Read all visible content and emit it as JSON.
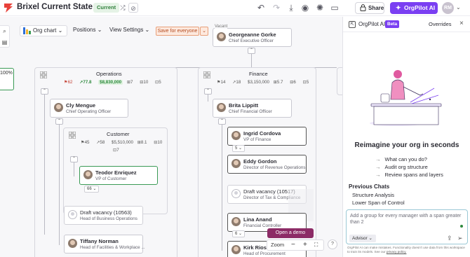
{
  "header": {
    "title": "Brixel Current State",
    "badge": "Current",
    "share_label": "Share",
    "orgpilot_label": "OrgPilot AI",
    "user_initials": "RM",
    "colors": {
      "accent": "#7a3ff2",
      "current_badge": "#2f7f3a"
    }
  },
  "toolbar": {
    "orgchart_label": "Org chart",
    "positions_label": "Positions",
    "view_settings_label": "View Settings",
    "save_label": "Save for everyone"
  },
  "chart": {
    "partial_left_label": "100%",
    "ceo": {
      "name": "Georgeanne Gorke",
      "role": "Chief Executive Officer",
      "tag": "Vacant"
    },
    "operations": {
      "title": "Operations",
      "stats": [
        "62",
        "77.8",
        "$8,830,000",
        "7",
        "10",
        "5"
      ],
      "head": {
        "name": "Cly Mengue",
        "role": "Chief Operating Officer"
      },
      "customer_group": {
        "title": "Customer",
        "stats": [
          "45",
          "58",
          "$5,510,000",
          "8.1",
          "10",
          "7"
        ],
        "head": {
          "name": "Teodor Enriquez",
          "role": "VP of Customer"
        },
        "count": "66"
      },
      "vacancy": {
        "name": "Draft vacancy (10563)",
        "role": "Head of Business Operations"
      },
      "tiffany": {
        "name": "Tiffany Norman",
        "role": "Head of Facilities & Workplace ..."
      }
    },
    "finance": {
      "title": "Finance",
      "stats": [
        "14",
        "18",
        "$3,150,000",
        "5.7",
        "6",
        "5"
      ],
      "head": {
        "name": "Brita Lippitt",
        "role": "Chief Financial Officer"
      },
      "ingrid": {
        "name": "Ingrid Cordova",
        "role": "VP of Finance",
        "count": "5"
      },
      "eddy": {
        "name": "Eddy Gordon",
        "role": "Director of Revenue Operations"
      },
      "vacancy": {
        "name": "Draft vacancy (10517)",
        "role": "Director of Tax & Compliance"
      },
      "lina": {
        "name": "Lina Anand",
        "role": "Financial Controller",
        "count": "6"
      },
      "kirk": {
        "name": "Kirk Rios",
        "role": "Head of Procurement"
      }
    },
    "open_demo_label": "Open a demo",
    "zoom_label": "Zoom",
    "zoom_out": "−",
    "zoom_in": "+",
    "help": "?"
  },
  "panel": {
    "title": "OrgPilot AI",
    "beta": "Beta",
    "overrides": "Overrides",
    "tagline": "Reimagine your org in seconds",
    "suggestions": [
      "What can you do?",
      "Audit org structure",
      "Review spans and layers"
    ],
    "previous_title": "Previous Chats",
    "previous": [
      "Structure Analysis",
      "Lower Span of Control"
    ],
    "input_text": "Add a group for every manager with a span greater than 2",
    "mode": "Advisor",
    "disclaimer": "OrgPilot AI can make mistakes. Functionality doesn't use data from this workspace to train its models. See our",
    "privacy_link": "privacy policy."
  }
}
